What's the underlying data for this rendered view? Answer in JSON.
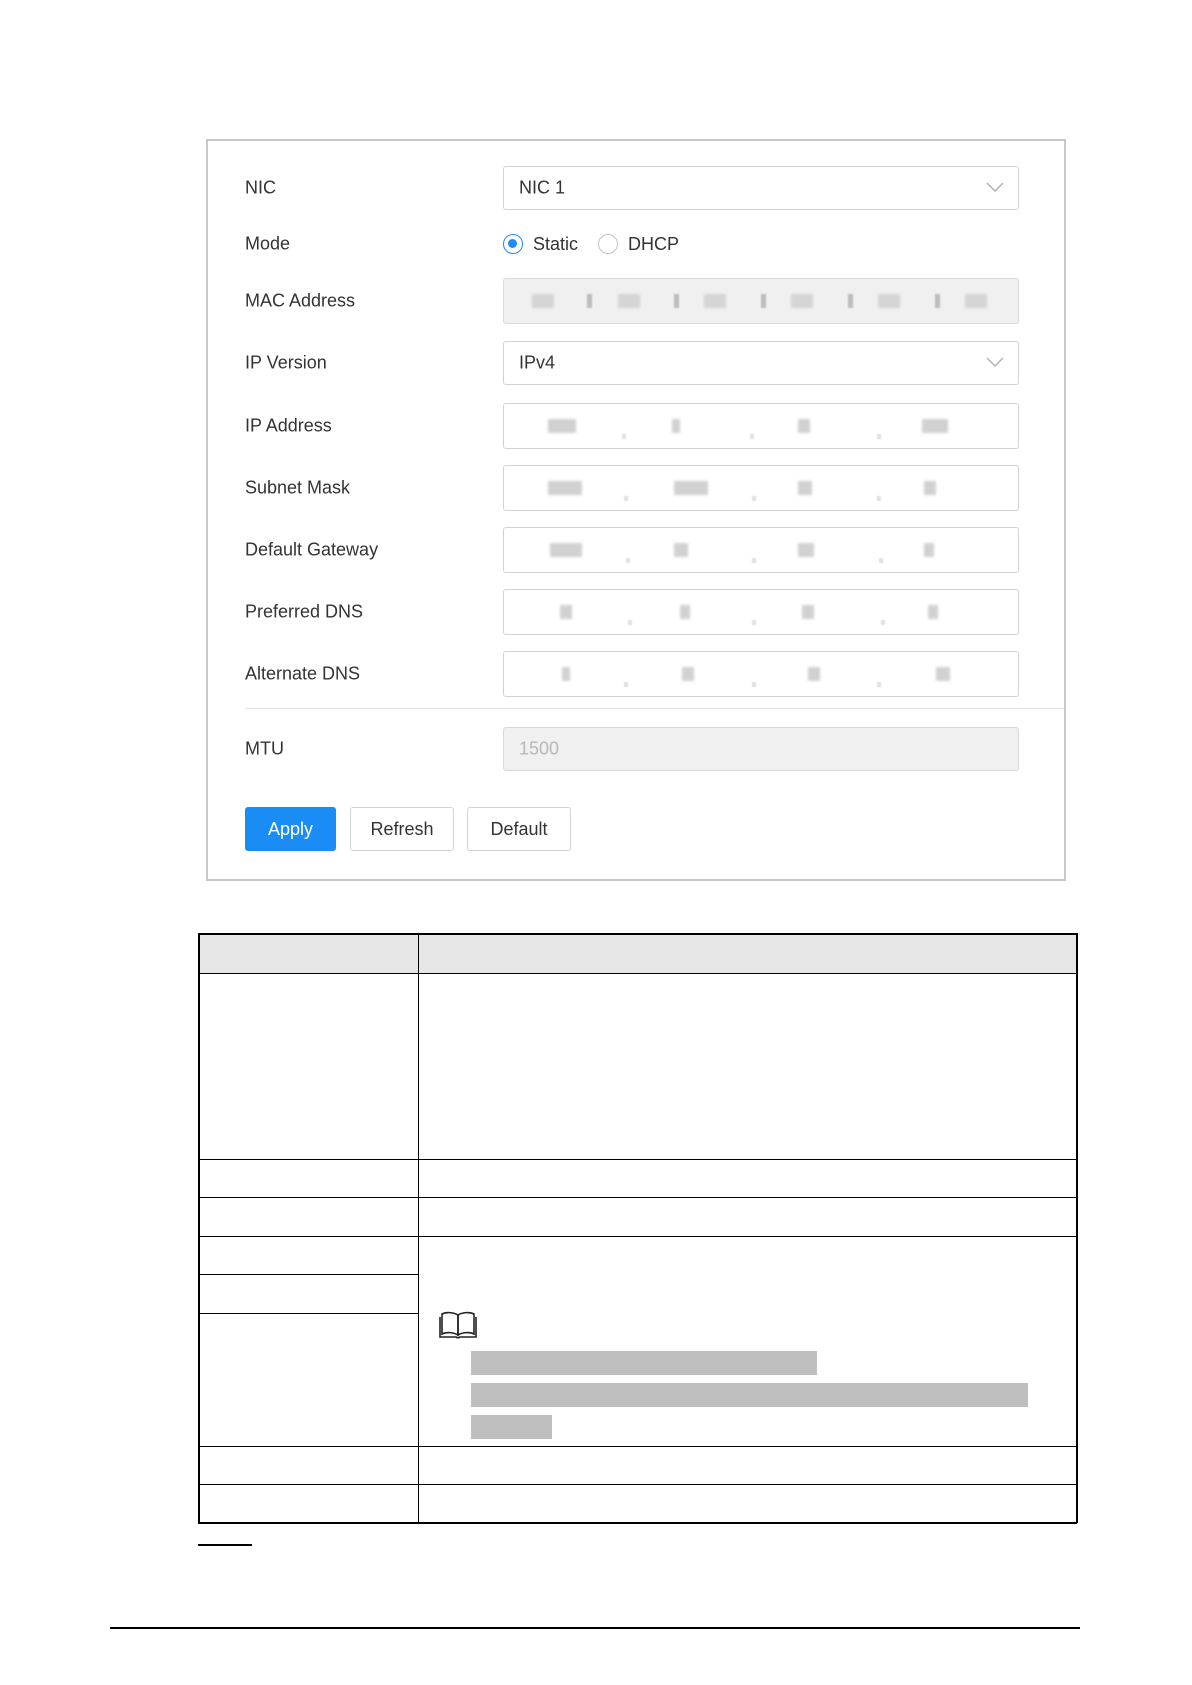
{
  "form": {
    "nic": {
      "label": "NIC",
      "value": "NIC 1"
    },
    "mode": {
      "label": "Mode",
      "options": [
        "Static",
        "DHCP"
      ],
      "selected": "Static"
    },
    "mac_address": {
      "label": "MAC Address"
    },
    "ip_version": {
      "label": "IP Version",
      "value": "IPv4"
    },
    "ip_address": {
      "label": "IP Address"
    },
    "subnet_mask": {
      "label": "Subnet Mask"
    },
    "default_gateway": {
      "label": "Default Gateway"
    },
    "preferred_dns": {
      "label": "Preferred DNS"
    },
    "alternate_dns": {
      "label": "Alternate DNS"
    },
    "mtu": {
      "label": "MTU",
      "value": "1500"
    }
  },
  "buttons": {
    "apply": "Apply",
    "refresh": "Refresh",
    "default": "Default"
  },
  "colors": {
    "accent": "#1a8cf5",
    "table_header": "#e6e6e6",
    "redacted": "#bfbfbf"
  },
  "icons": {
    "note": "book-icon",
    "dropdown": "chevron-down-icon"
  }
}
